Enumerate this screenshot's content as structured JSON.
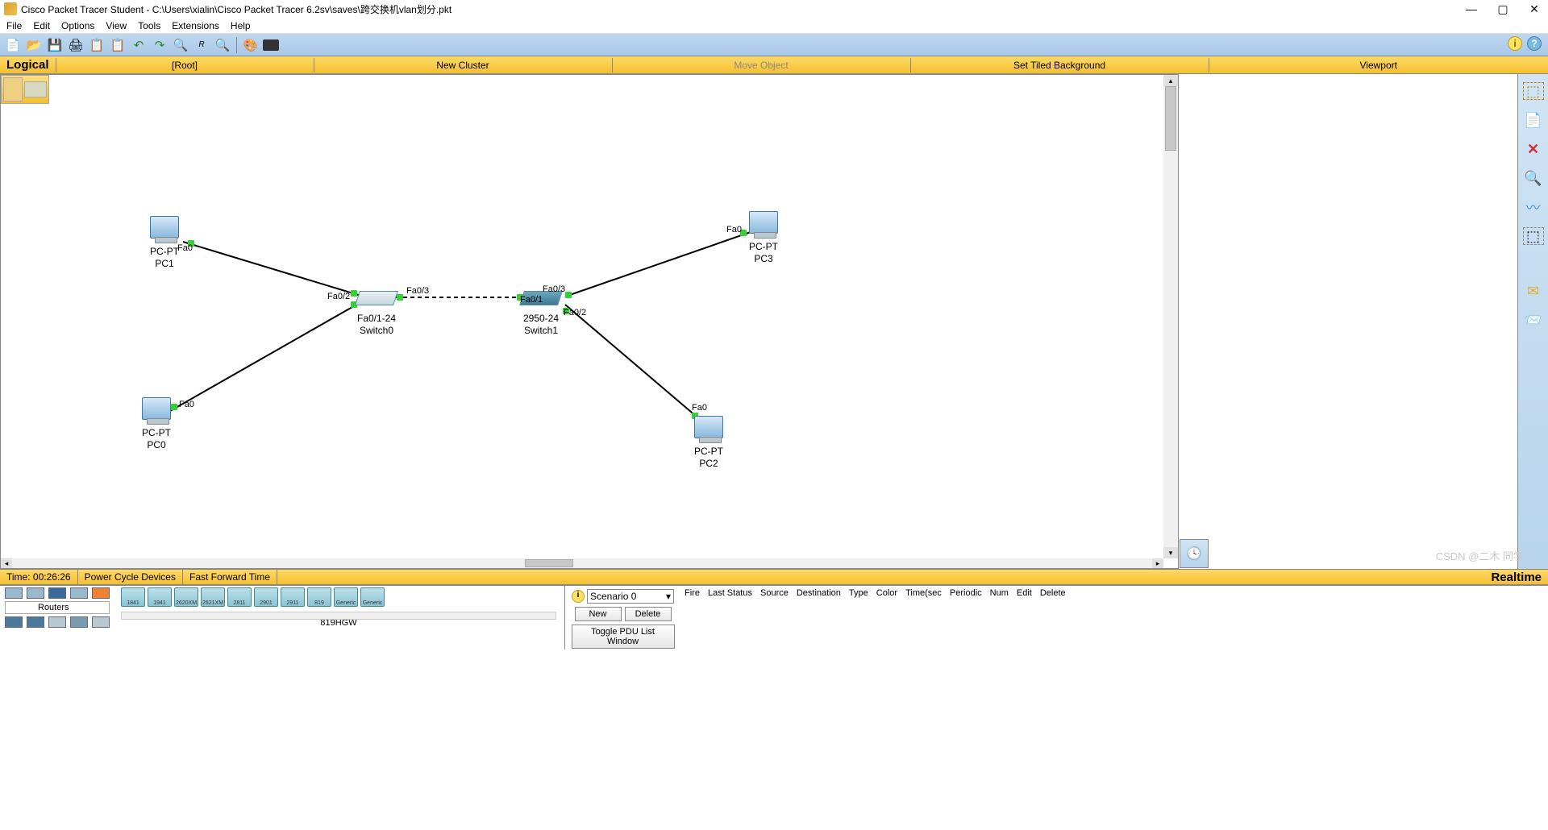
{
  "title": "Cisco Packet Tracer Student - C:\\Users\\xialin\\Cisco Packet Tracer 6.2sv\\saves\\跨交换机vlan划分.pkt",
  "menu": {
    "file": "File",
    "edit": "Edit",
    "options": "Options",
    "view": "View",
    "tools": "Tools",
    "extensions": "Extensions",
    "help": "Help"
  },
  "yellowbar": {
    "logical": "Logical",
    "root": "[Root]",
    "newcluster": "New Cluster",
    "moveobj": "Move Object",
    "tiled": "Set Tiled Background",
    "viewport": "Viewport"
  },
  "status": {
    "time": "Time: 00:26:26",
    "pcd": "Power Cycle Devices",
    "fft": "Fast Forward Time",
    "realtime": "Realtime"
  },
  "palette": {
    "category": "Routers",
    "devices": [
      "1841",
      "1941",
      "2620XM",
      "2621XM",
      "2811",
      "2901",
      "2911",
      "819",
      "Generic",
      "Generic"
    ],
    "hover": "819HGW"
  },
  "sim": {
    "scenario": "Scenario 0",
    "new": "New",
    "delete": "Delete",
    "toggle": "Toggle PDU List Window"
  },
  "pdu": {
    "fire": "Fire",
    "last": "Last Status",
    "source": "Source",
    "dest": "Destination",
    "type": "Type",
    "color": "Color",
    "time": "Time(sec",
    "periodic": "Periodic",
    "num": "Num",
    "edit": "Edit",
    "del": "Delete"
  },
  "nodes": {
    "pc1": {
      "t": "PC-PT",
      "n": "PC1",
      "port": "Fa0"
    },
    "pc0": {
      "t": "PC-PT",
      "n": "PC0",
      "port": "Fa0"
    },
    "pc2": {
      "t": "PC-PT",
      "n": "PC2",
      "port": "Fa0"
    },
    "pc3": {
      "t": "PC-PT",
      "n": "PC3",
      "port": "Fa0"
    },
    "sw0": {
      "t": "Fa0/1-24",
      "n": "Switch0",
      "p1": "Fa0/2",
      "p2": "Fa0/3"
    },
    "sw1": {
      "t": "2950-24",
      "n": "Switch1",
      "p1": "Fa0/1",
      "p2": "Fa0/2",
      "p3": "Fa0/3"
    }
  },
  "watermark": "CSDN @二木 同学"
}
